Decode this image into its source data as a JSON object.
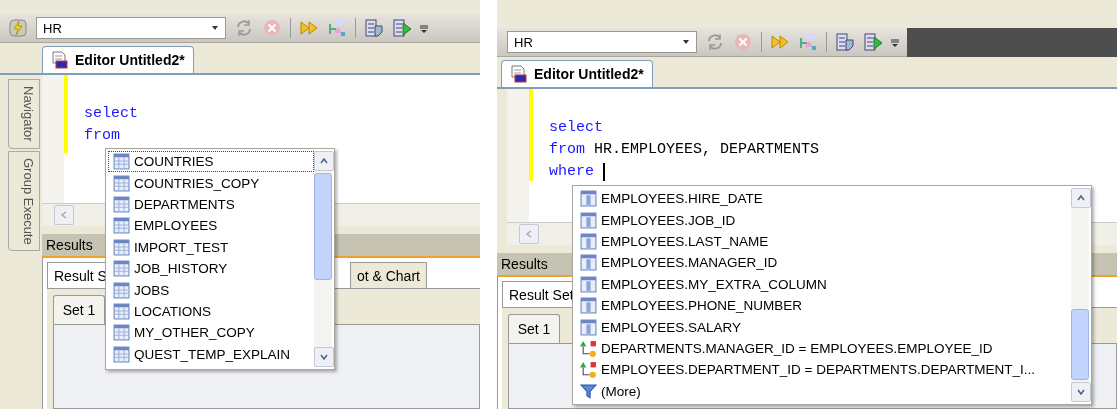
{
  "panels": [
    {
      "toolbar": {
        "connection": "HR"
      },
      "editor_tab": {
        "label": "Editor Untitled2*",
        "selected": true
      },
      "side_tabs": [
        {
          "label": "Navigator",
          "selected": false
        },
        {
          "label": "Group Execute",
          "selected": false
        }
      ],
      "code": [
        [
          {
            "text": "select",
            "kind": "keyword"
          }
        ],
        [
          {
            "text": "from",
            "kind": "keyword"
          }
        ]
      ],
      "caret": false,
      "results": {
        "title": "Results",
        "tabs": [
          {
            "label": "Result S",
            "selected": true
          },
          {
            "label": "ot & Chart",
            "selected": false
          }
        ],
        "set_tab": {
          "label": "Set 1",
          "selected": true
        }
      },
      "popup": {
        "items": [
          {
            "label": "COUNTRIES",
            "kind": "table",
            "selected": true
          },
          {
            "label": "COUNTRIES_COPY",
            "kind": "table",
            "selected": false
          },
          {
            "label": "DEPARTMENTS",
            "kind": "table",
            "selected": false
          },
          {
            "label": "EMPLOYEES",
            "kind": "table",
            "selected": false
          },
          {
            "label": "IMPORT_TEST",
            "kind": "table",
            "selected": false
          },
          {
            "label": "JOB_HISTORY",
            "kind": "table",
            "selected": false
          },
          {
            "label": "JOBS",
            "kind": "table",
            "selected": false
          },
          {
            "label": "LOCATIONS",
            "kind": "table",
            "selected": false
          },
          {
            "label": "MY_OTHER_COPY",
            "kind": "table",
            "selected": false
          },
          {
            "label": "QUEST_TEMP_EXPLAIN",
            "kind": "table",
            "selected": false
          }
        ]
      }
    },
    {
      "toolbar": {
        "connection": "HR"
      },
      "editor_tab": {
        "label": "Editor Untitled2*",
        "selected": true
      },
      "code": [
        [
          {
            "text": "select",
            "kind": "keyword"
          }
        ],
        [
          {
            "text": "from",
            "kind": "keyword"
          },
          {
            "text": "HR.EMPLOYEES, DEPARTMENTS",
            "kind": "plain"
          }
        ],
        [
          {
            "text": "where",
            "kind": "keyword"
          }
        ]
      ],
      "caret": true,
      "results": {
        "title": "Results",
        "tabs": [
          {
            "label": "Result Set",
            "selected": true
          }
        ],
        "set_tab": {
          "label": "Set 1",
          "selected": true
        }
      },
      "popup": {
        "items": [
          {
            "label": "EMPLOYEES.HIRE_DATE",
            "kind": "column",
            "selected": false
          },
          {
            "label": "EMPLOYEES.JOB_ID",
            "kind": "column",
            "selected": false
          },
          {
            "label": "EMPLOYEES.LAST_NAME",
            "kind": "column",
            "selected": false
          },
          {
            "label": "EMPLOYEES.MANAGER_ID",
            "kind": "column",
            "selected": false
          },
          {
            "label": "EMPLOYEES.MY_EXTRA_COLUMN",
            "kind": "column",
            "selected": false
          },
          {
            "label": "EMPLOYEES.PHONE_NUMBER",
            "kind": "column",
            "selected": false
          },
          {
            "label": "EMPLOYEES.SALARY",
            "kind": "column",
            "selected": false
          },
          {
            "label": "DEPARTMENTS.MANAGER_ID = EMPLOYEES.EMPLOYEE_ID",
            "kind": "join",
            "selected": false
          },
          {
            "label": "EMPLOYEES.DEPARTMENT_ID = DEPARTMENTS.DEPARTMENT_I...",
            "kind": "join",
            "selected": false
          },
          {
            "label": "(More)",
            "kind": "more",
            "selected": false
          }
        ]
      }
    }
  ]
}
